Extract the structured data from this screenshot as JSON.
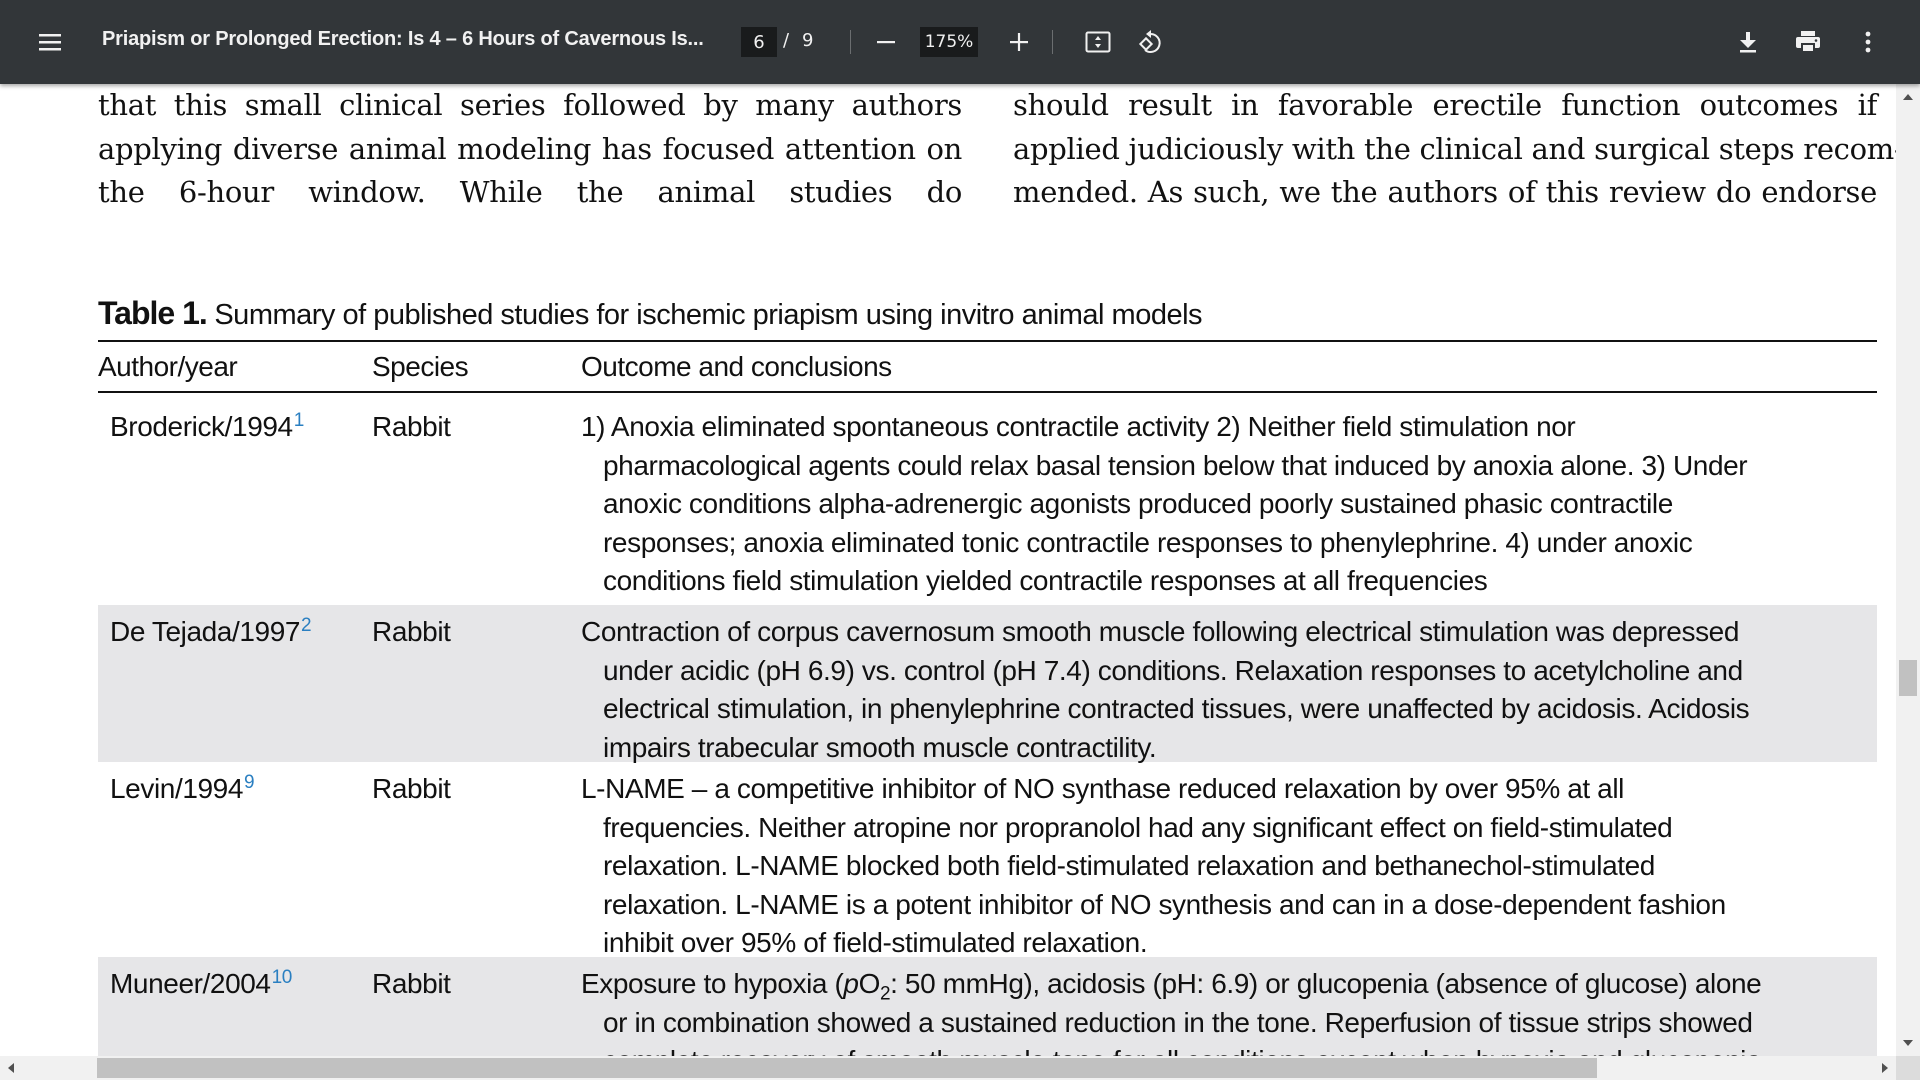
{
  "toolbar": {
    "menu_icon": "hamburger-menu-icon",
    "title": "Priapism or Prolonged Erection: Is 4 – 6 Hours of Cavernous Is...",
    "current_page": "6",
    "page_separator": "/",
    "total_pages": "9",
    "zoom_out_icon": "minus-icon",
    "zoom_level": "175%",
    "zoom_in_icon": "plus-icon",
    "fit_icon": "fit-to-page-icon",
    "rotate_icon": "rotate-counterclockwise-icon",
    "download_icon": "download-icon",
    "print_icon": "print-icon",
    "more_icon": "more-vertical-icon"
  },
  "document": {
    "left_column_lines": [
      "that this small clinical series followed by many authors",
      "applying diverse animal modeling has focused attention on",
      "the 6-hour window. While the animal studies do"
    ],
    "right_column_lines": [
      "should result in favorable erectile function outcomes if",
      "applied judiciously with the clinical and surgical steps recom-",
      "mended. As such, we the authors of this review do endorse"
    ],
    "table": {
      "caption_label": "Table 1.",
      "caption_text": "Summary of published studies for ischemic priapism using invitro animal models",
      "headers": [
        "Author/year",
        "Species",
        "Outcome and conclusions"
      ],
      "rows": [
        {
          "author": "Broderick/1994",
          "ref": "1",
          "species": "Rabbit",
          "outcome_lines": [
            "1) Anoxia eliminated spontaneous contractile activity 2) Neither field stimulation nor",
            "pharmacological agents could relax basal tension below that induced by anoxia alone. 3) Under",
            "anoxic conditions alpha-adrenergic agonists produced poorly sustained phasic contractile",
            "responses; anoxia eliminated tonic contractile responses to phenylephrine. 4) under anoxic",
            "conditions field stimulation yielded contractile responses at all frequencies"
          ]
        },
        {
          "author": "De Tejada/1997",
          "ref": "2",
          "species": "Rabbit",
          "outcome_lines": [
            "Contraction of corpus cavernosum smooth muscle following electrical stimulation was depressed",
            "under acidic (pH 6.9) vs. control (pH 7.4) conditions. Relaxation responses to acetylcholine and",
            "electrical stimulation, in phenylephrine contracted tissues, were unaffected by acidosis. Acidosis",
            "impairs trabecular smooth muscle contractility."
          ]
        },
        {
          "author": "Levin/1994",
          "ref": "9",
          "species": "Rabbit",
          "outcome_lines": [
            "L-NAME – a competitive inhibitor of NO synthase reduced relaxation by over 95% at all",
            "frequencies. Neither atropine nor propranolol had any significant effect on field-stimulated",
            "relaxation. L-NAME blocked both field-stimulated relaxation and bethanechol-stimulated",
            "relaxation. L-NAME is a potent inhibitor of NO synthesis and can in a dose-dependent fashion",
            "inhibit over 95% of field-stimulated relaxation."
          ]
        },
        {
          "author": "Muneer/2004",
          "ref": "10",
          "species": "Rabbit",
          "outcome_line1_prefix": "Exposure to hypoxia (",
          "outcome_line1_italic": "p",
          "outcome_line1_o": "O",
          "outcome_line1_sub": "2",
          "outcome_line1_suffix": ": 50 mmHg), acidosis (pH: 6.9) or glucopenia (absence of glucose) alone",
          "outcome_lines_rest": [
            "or in combination showed a sustained reduction in the tone. Reperfusion of tissue strips showed",
            "complete recovery of smooth muscle tone for all conditions except when hypoxia and glucopenia"
          ]
        }
      ]
    }
  },
  "colors": {
    "toolbar_bg": "#323639",
    "toolbar_text": "#f1f1f1",
    "input_bg": "#191b1c",
    "shaded_row": "#e6e6e8",
    "ref_link": "#2a7fc1",
    "scrollbar_track": "#f1f1f1",
    "scrollbar_thumb": "#c1c1c1"
  }
}
